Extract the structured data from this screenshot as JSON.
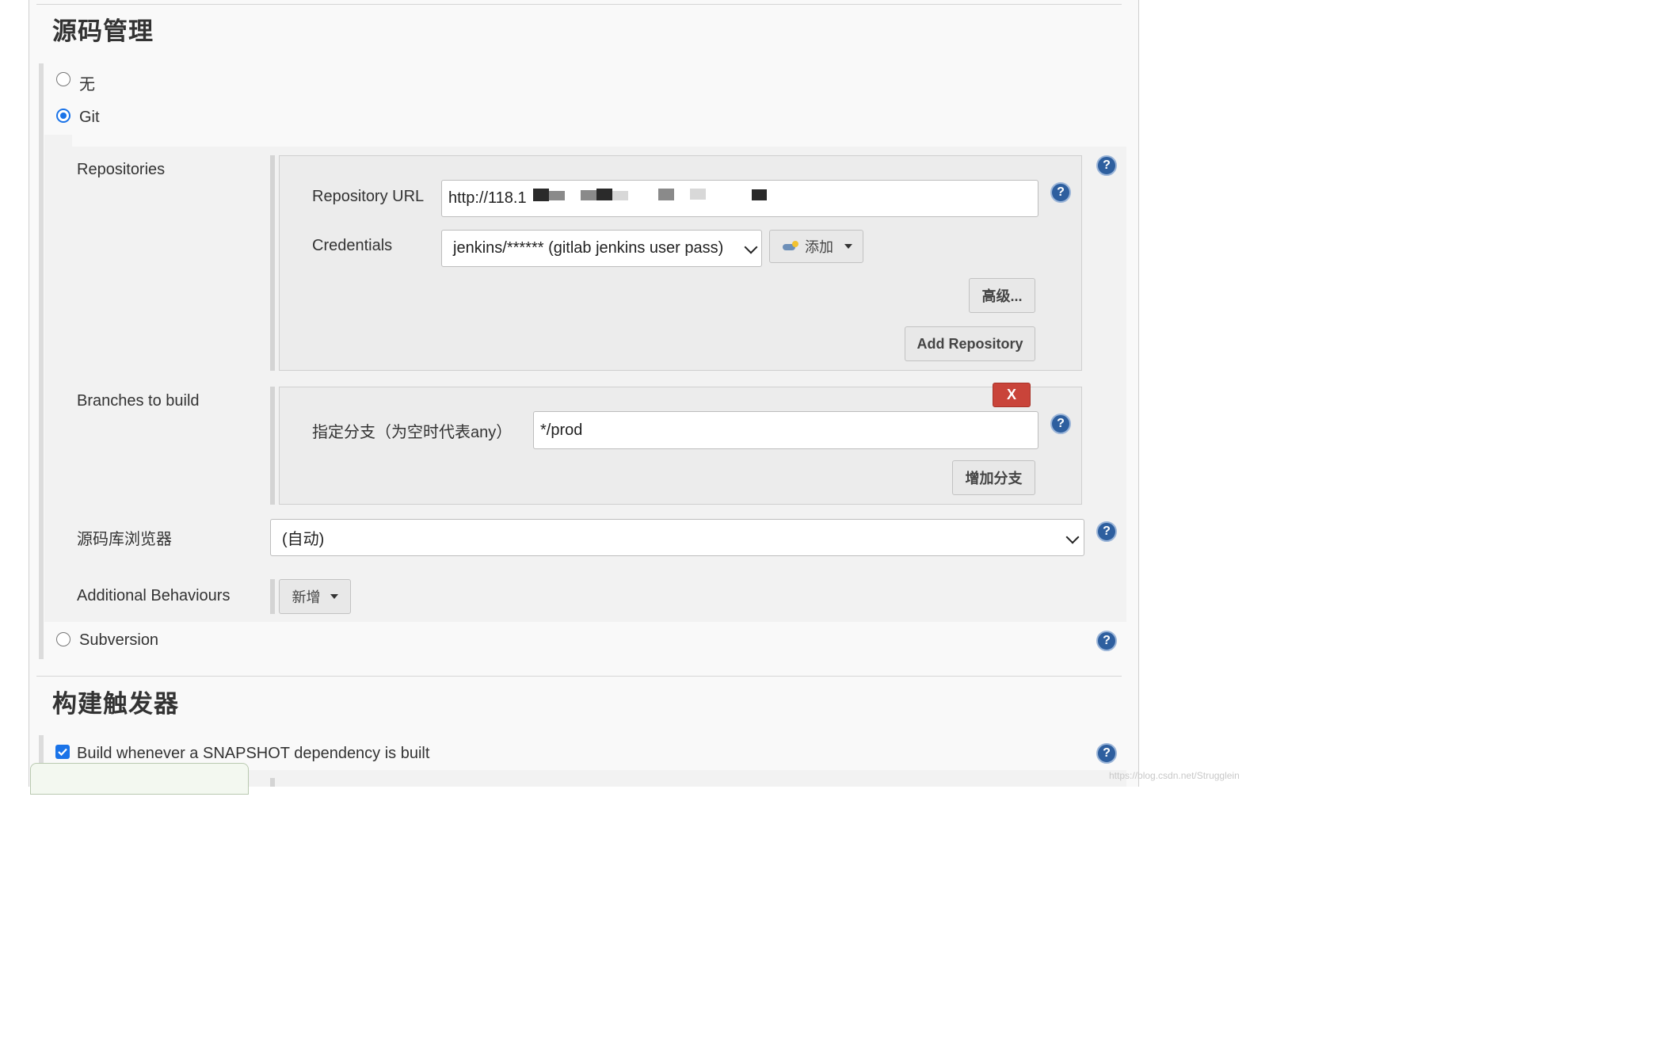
{
  "scm": {
    "title": "源码管理",
    "options": {
      "none": "无",
      "git": "Git",
      "subversion": "Subversion"
    },
    "git": {
      "repositories_label": "Repositories",
      "repository_url_label": "Repository URL",
      "repository_url_value": "http://118.1",
      "credentials_label": "Credentials",
      "credentials_selected": "jenkins/****** (gitlab jenkins user pass)",
      "add_credentials_label": "添加",
      "advanced_label": "高级...",
      "add_repository_label": "Add Repository",
      "branches_label": "Branches to build",
      "branch_spec_label": "指定分支（为空时代表any）",
      "branch_spec_value": "*/prod",
      "delete_branch_label": "X",
      "add_branch_label": "增加分支",
      "repo_browser_label": "源码库浏览器",
      "repo_browser_selected": "(自动)",
      "additional_behaviours_label": "Additional Behaviours",
      "add_behaviour_label": "新增"
    }
  },
  "triggers": {
    "title": "构建触发器",
    "snapshot_label": "Build whenever a SNAPSHOT dependency is built",
    "snapshot_checked": true
  },
  "help_icon_glyph": "?",
  "watermark": "https://blog.csdn.net/Strugglein",
  "colors": {
    "accent_blue": "#1a73e8",
    "help_blue": "#2e5f9f",
    "delete_red": "#c9443a"
  }
}
